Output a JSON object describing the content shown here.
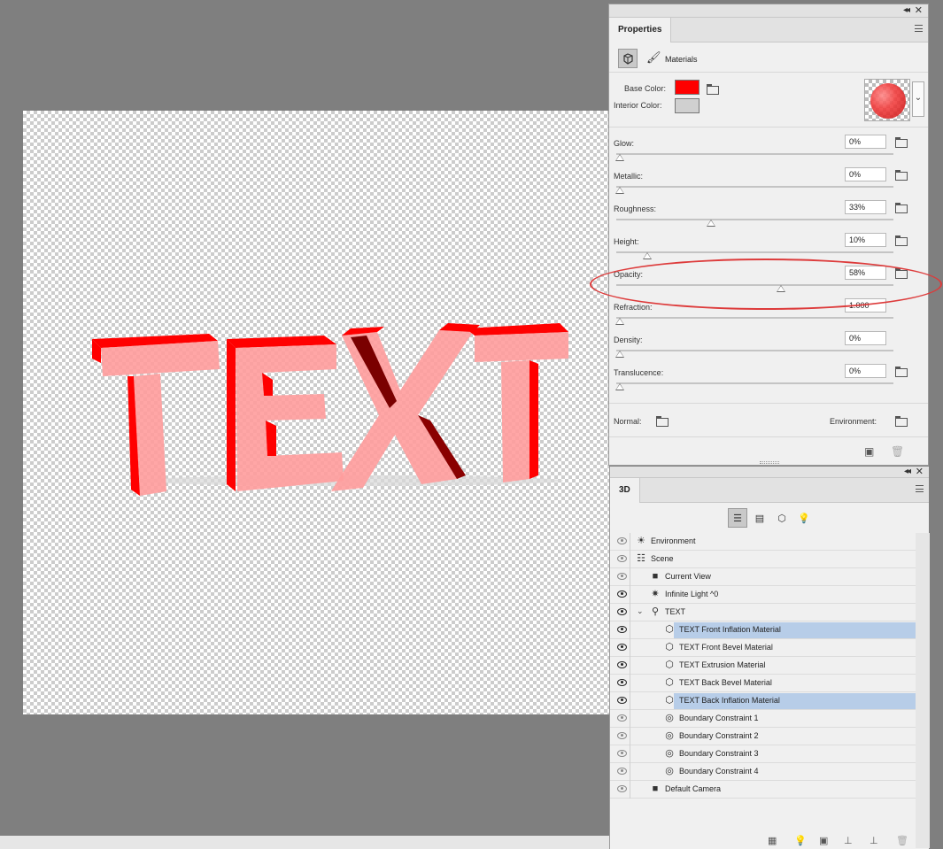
{
  "properties_panel": {
    "tab_label": "Properties",
    "mode_label": "Materials",
    "base_color_label": "Base Color:",
    "interior_color_label": "Interior Color:",
    "base_color": "#ff0000",
    "interior_color": "#d0d0d0",
    "sliders": [
      {
        "label": "Glow:",
        "value": "0%",
        "level": 0
      },
      {
        "label": "Metallic:",
        "value": "0%",
        "level": 0
      },
      {
        "label": "Roughness:",
        "value": "33%",
        "level": 33
      },
      {
        "label": "Height:",
        "value": "10%",
        "level": 10
      },
      {
        "label": "Opacity:",
        "value": "58%",
        "level": 58
      },
      {
        "label": "Refraction:",
        "value": "1.000",
        "level": 0
      },
      {
        "label": "Density:",
        "value": "0%",
        "level": 0
      },
      {
        "label": "Translucence:",
        "value": "0%",
        "level": 0
      }
    ],
    "normal_label": "Normal:",
    "environment_label": "Environment:"
  },
  "panel_3d": {
    "tab_label": "3D",
    "tree": [
      {
        "label": "Environment",
        "icon": "environment-icon",
        "eye": "dim"
      },
      {
        "label": "Scene",
        "icon": "scene-icon",
        "eye": "dim"
      },
      {
        "label": "Current View",
        "icon": "camera-icon",
        "eye": "dim"
      },
      {
        "label": "Infinite Light ^0",
        "icon": "light-icon",
        "eye": "on"
      },
      {
        "label": "TEXT",
        "icon": "mesh-icon",
        "eye": "on"
      },
      {
        "label": "TEXT Front Inflation Material",
        "icon": "material-icon",
        "eye": "on",
        "selected": true
      },
      {
        "label": "TEXT Front Bevel Material",
        "icon": "material-icon",
        "eye": "on"
      },
      {
        "label": "TEXT Extrusion Material",
        "icon": "material-icon",
        "eye": "on"
      },
      {
        "label": "TEXT Back Bevel Material",
        "icon": "material-icon",
        "eye": "on"
      },
      {
        "label": "TEXT Back Inflation Material",
        "icon": "material-icon",
        "eye": "on",
        "selected": true
      },
      {
        "label": "Boundary Constraint 1",
        "icon": "constraint-icon",
        "eye": "dim"
      },
      {
        "label": "Boundary Constraint 2",
        "icon": "constraint-icon",
        "eye": "dim"
      },
      {
        "label": "Boundary Constraint 3",
        "icon": "constraint-icon",
        "eye": "dim"
      },
      {
        "label": "Boundary Constraint 4",
        "icon": "constraint-icon",
        "eye": "dim"
      },
      {
        "label": "Default Camera",
        "icon": "camera-icon",
        "eye": "dim"
      }
    ]
  },
  "canvas": {
    "text_3d": "TEXT",
    "text_color": "#ff0000"
  }
}
